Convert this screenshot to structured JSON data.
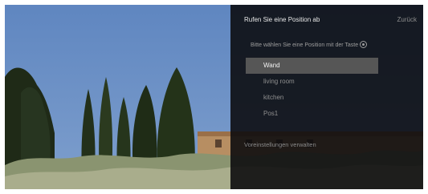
{
  "dialog": {
    "title": "Rufen Sie eine Position ab",
    "back_label": "Zurück",
    "instruction": "Bitte wählen Sie eine Position mit der Taste",
    "instruction_icon": "ok-key-icon",
    "positions": [
      {
        "label": "Wand",
        "selected": true
      },
      {
        "label": "living room",
        "selected": false
      },
      {
        "label": "kitchen",
        "selected": false
      },
      {
        "label": "Pos1",
        "selected": false
      }
    ],
    "presets_link": "Voreinstellungen verwalten"
  },
  "colors": {
    "sky": "#6f93c6",
    "panel": "#0a0a0c",
    "selected_row": "#565656",
    "text_primary": "#e6e6e6",
    "text_secondary": "#8f8f8f"
  }
}
